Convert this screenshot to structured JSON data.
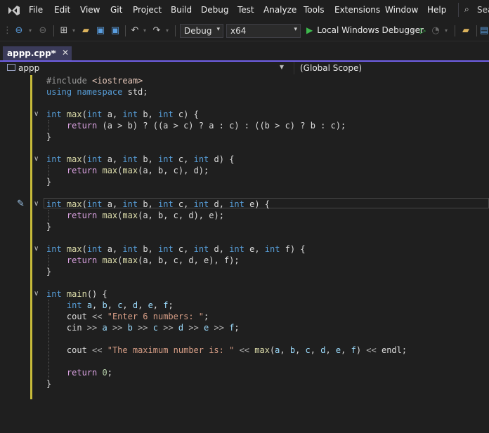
{
  "menu": {
    "items": [
      "File",
      "Edit",
      "View",
      "Git",
      "Project",
      "Build",
      "Debug",
      "Test",
      "Analyze",
      "Tools",
      "Extensions",
      "Window",
      "Help"
    ],
    "search_label": "Sea"
  },
  "toolbar": {
    "configuration": "Debug",
    "platform": "x64",
    "debugger_label": "Local Windows Debugger"
  },
  "tabs": [
    {
      "label": "appp.cpp*"
    }
  ],
  "navigation": {
    "project": "appp",
    "scope": "(Global Scope)"
  },
  "code": {
    "lines": [
      [
        [
          "pp",
          "#include "
        ],
        [
          "inc",
          "<iostream>"
        ]
      ],
      [
        [
          "kw",
          "using namespace "
        ],
        [
          "txt",
          "std;"
        ]
      ],
      [],
      [
        [
          "kw",
          "int "
        ],
        [
          "fn",
          "max"
        ],
        [
          "txt",
          "("
        ],
        [
          "kw",
          "int "
        ],
        [
          "txt",
          "a, "
        ],
        [
          "kw",
          "int "
        ],
        [
          "txt",
          "b, "
        ],
        [
          "kw",
          "int "
        ],
        [
          "txt",
          "c) {"
        ]
      ],
      [
        [
          "txt",
          "    "
        ],
        [
          "ctl",
          "return "
        ],
        [
          "txt",
          "(a > b) ? ((a > c) ? a : c) : ((b > c) ? b : c);"
        ]
      ],
      [
        [
          "txt",
          "}"
        ]
      ],
      [],
      [
        [
          "kw",
          "int "
        ],
        [
          "fn",
          "max"
        ],
        [
          "txt",
          "("
        ],
        [
          "kw",
          "int "
        ],
        [
          "txt",
          "a, "
        ],
        [
          "kw",
          "int "
        ],
        [
          "txt",
          "b, "
        ],
        [
          "kw",
          "int "
        ],
        [
          "txt",
          "c, "
        ],
        [
          "kw",
          "int "
        ],
        [
          "txt",
          "d) {"
        ]
      ],
      [
        [
          "txt",
          "    "
        ],
        [
          "ctl",
          "return "
        ],
        [
          "fn",
          "max"
        ],
        [
          "txt",
          "("
        ],
        [
          "fn",
          "max"
        ],
        [
          "txt",
          "(a, b, c), d);"
        ]
      ],
      [
        [
          "txt",
          "}"
        ]
      ],
      [],
      [
        [
          "kw",
          "int "
        ],
        [
          "fn",
          "max"
        ],
        [
          "txt",
          "("
        ],
        [
          "kw",
          "int "
        ],
        [
          "txt",
          "a, "
        ],
        [
          "kw",
          "int "
        ],
        [
          "txt",
          "b, "
        ],
        [
          "kw",
          "int "
        ],
        [
          "txt",
          "c, "
        ],
        [
          "kw",
          "int "
        ],
        [
          "txt",
          "d, "
        ],
        [
          "kw",
          "int "
        ],
        [
          "txt",
          "e) {"
        ]
      ],
      [
        [
          "txt",
          "    "
        ],
        [
          "ctl",
          "return "
        ],
        [
          "fn",
          "max"
        ],
        [
          "txt",
          "("
        ],
        [
          "fn",
          "max"
        ],
        [
          "txt",
          "(a, b, c, d), e);"
        ]
      ],
      [
        [
          "txt",
          "}"
        ]
      ],
      [],
      [
        [
          "kw",
          "int "
        ],
        [
          "fn",
          "max"
        ],
        [
          "txt",
          "("
        ],
        [
          "kw",
          "int "
        ],
        [
          "txt",
          "a, "
        ],
        [
          "kw",
          "int "
        ],
        [
          "txt",
          "b, "
        ],
        [
          "kw",
          "int "
        ],
        [
          "txt",
          "c, "
        ],
        [
          "kw",
          "int "
        ],
        [
          "txt",
          "d, "
        ],
        [
          "kw",
          "int "
        ],
        [
          "txt",
          "e, "
        ],
        [
          "kw",
          "int "
        ],
        [
          "txt",
          "f) {"
        ]
      ],
      [
        [
          "txt",
          "    "
        ],
        [
          "ctl",
          "return "
        ],
        [
          "fn",
          "max"
        ],
        [
          "txt",
          "("
        ],
        [
          "fn",
          "max"
        ],
        [
          "txt",
          "(a, b, c, d, e), f);"
        ]
      ],
      [
        [
          "txt",
          "}"
        ]
      ],
      [],
      [
        [
          "kw",
          "int "
        ],
        [
          "fn",
          "main"
        ],
        [
          "txt",
          "() {"
        ]
      ],
      [
        [
          "txt",
          "    "
        ],
        [
          "kw",
          "int "
        ],
        [
          "var",
          "a"
        ],
        [
          "txt",
          ", "
        ],
        [
          "var",
          "b"
        ],
        [
          "txt",
          ", "
        ],
        [
          "var",
          "c"
        ],
        [
          "txt",
          ", "
        ],
        [
          "var",
          "d"
        ],
        [
          "txt",
          ", "
        ],
        [
          "var",
          "e"
        ],
        [
          "txt",
          ", "
        ],
        [
          "var",
          "f"
        ],
        [
          "txt",
          ";"
        ]
      ],
      [
        [
          "txt",
          "    cout "
        ],
        [
          "op",
          "<< "
        ],
        [
          "str",
          "\"Enter 6 numbers: \""
        ],
        [
          "txt",
          ";"
        ]
      ],
      [
        [
          "txt",
          "    cin "
        ],
        [
          "op",
          ">> "
        ],
        [
          "var",
          "a "
        ],
        [
          "op",
          ">> "
        ],
        [
          "var",
          "b "
        ],
        [
          "op",
          ">> "
        ],
        [
          "var",
          "c "
        ],
        [
          "op",
          ">> "
        ],
        [
          "var",
          "d "
        ],
        [
          "op",
          ">> "
        ],
        [
          "var",
          "e "
        ],
        [
          "op",
          ">> "
        ],
        [
          "var",
          "f"
        ],
        [
          "txt",
          ";"
        ]
      ],
      [],
      [
        [
          "txt",
          "    cout "
        ],
        [
          "op",
          "<< "
        ],
        [
          "str",
          "\"The maximum number is: \" "
        ],
        [
          "op",
          "<< "
        ],
        [
          "fn",
          "max"
        ],
        [
          "txt",
          "("
        ],
        [
          "var",
          "a"
        ],
        [
          "txt",
          ", "
        ],
        [
          "var",
          "b"
        ],
        [
          "txt",
          ", "
        ],
        [
          "var",
          "c"
        ],
        [
          "txt",
          ", "
        ],
        [
          "var",
          "d"
        ],
        [
          "txt",
          ", "
        ],
        [
          "var",
          "e"
        ],
        [
          "txt",
          ", "
        ],
        [
          "var",
          "f"
        ],
        [
          "txt",
          ") "
        ],
        [
          "op",
          "<< "
        ],
        [
          "txt",
          "endl;"
        ]
      ],
      [],
      [
        [
          "txt",
          "    "
        ],
        [
          "ctl",
          "return "
        ],
        [
          "num",
          "0"
        ],
        [
          "txt",
          ";"
        ]
      ],
      [
        [
          "txt",
          "}"
        ]
      ]
    ]
  }
}
